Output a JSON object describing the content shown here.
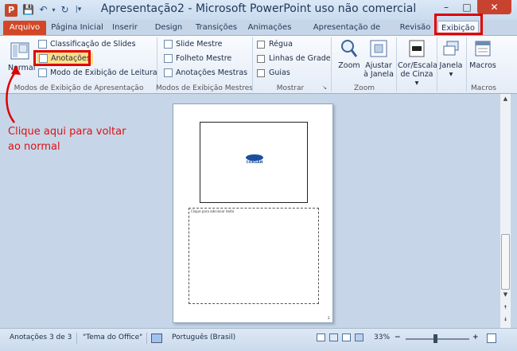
{
  "title_bar": {
    "title": "Apresentação2 - Microsoft PowerPoint uso não comercial",
    "app_icon_letter": "P",
    "minimize_glyph": "–",
    "maximize_glyph": "□",
    "close_glyph": "✕",
    "qat_save_glyph": "💾",
    "qat_undo_glyph": "↶",
    "qat_undo_arrow": "▾",
    "qat_redo_glyph": "↻",
    "qat_customize_glyph": "|▾"
  },
  "ribbon_tabs": [
    "Arquivo",
    "Página Inicial",
    "Inserir",
    "Design",
    "Transições",
    "Animações",
    "Apresentação de Slides",
    "Revisão",
    "Exibição"
  ],
  "ribbon_right_icons": {
    "collapse": "▵",
    "help": "?"
  },
  "groups": {
    "presentation_views": {
      "label": "Modos de Exibição de Apresentação",
      "normal": "Normal",
      "items": [
        "Classificação de Slides",
        "Anotações",
        "Modo de Exibição de Leitura"
      ]
    },
    "master_views": {
      "label": "Modos de Exibição Mestres",
      "items": [
        "Slide Mestre",
        "Folheto Mestre",
        "Anotações Mestras"
      ]
    },
    "show": {
      "label": "Mostrar",
      "items": [
        "Régua",
        "Linhas de Grade",
        "Guias"
      ],
      "launcher": "↘"
    },
    "zoom": {
      "label": "Zoom",
      "zoom_btn": "Zoom",
      "fit_btn_line1": "Ajustar",
      "fit_btn_line2": "à Janela"
    },
    "color": {
      "line1": "Cor/Escala",
      "line2": "de Cinza ▾"
    },
    "window": {
      "label": "Janela",
      "arrow": "▾"
    },
    "macros": {
      "label": "Macros",
      "group_label": "Macros"
    }
  },
  "annotation": {
    "line1": "Clique aqui para voltar",
    "line2": "ao normal"
  },
  "page": {
    "logo_text": "CORSAN",
    "notes_placeholder": "Clique para adicionar texto",
    "page_number": "2"
  },
  "status_bar": {
    "slide_info": "Anotações 3 de 3",
    "theme": "\"Tema do Office\"",
    "language": "Português (Brasil)",
    "zoom": "33%",
    "zoom_minus": "−",
    "zoom_plus": "+"
  },
  "scrollbar": {
    "up": "▲",
    "down": "▼",
    "prev": "⯭",
    "next": "⯯"
  }
}
